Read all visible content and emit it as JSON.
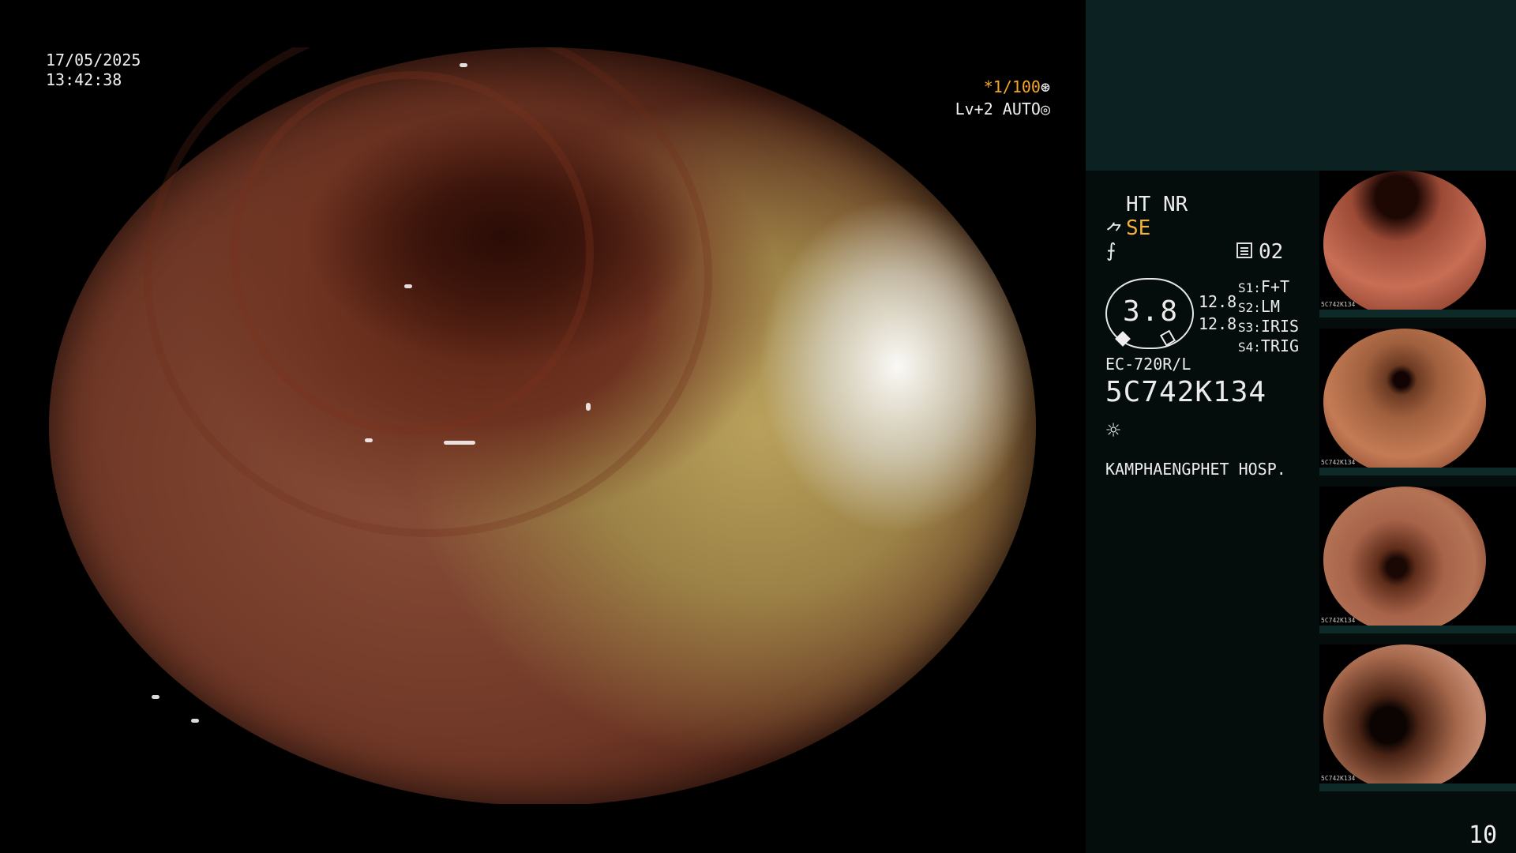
{
  "overlay": {
    "date": "17/05/2025",
    "time": "13:42:38",
    "shutter": "*1/100",
    "level": "Lv+2 AUTO"
  },
  "panel": {
    "mode": "HT NR",
    "se_label": "SE",
    "memo_value": "02",
    "dial_value": "3.8",
    "side_values": [
      "12.8",
      "12.8"
    ],
    "switches": [
      {
        "label": "S1:",
        "value": "F+T"
      },
      {
        "label": "S2:",
        "value": "LM"
      },
      {
        "label": "S3:",
        "value": "IRIS"
      },
      {
        "label": "S4:",
        "value": "TRIG"
      }
    ],
    "scope_model": "EC-720R/L",
    "scope_serial": "5C742K134",
    "hospital": "KAMPHAENGPHET HOSP."
  },
  "thumbnails": [
    {
      "caption": "5C742K134"
    },
    {
      "caption": "5C742K134"
    },
    {
      "caption": "5C742K134"
    },
    {
      "caption": "5C742K134"
    }
  ],
  "page_number": "10",
  "icons": {
    "shutter_icon": "shutter-icon",
    "auto_icon": "auto-icon",
    "se_icon": "scissor-icon",
    "hook_icon": "knife-icon",
    "memo_icon": "memo-icon",
    "light_icon": "sun-icon"
  },
  "colors": {
    "accent": "#f5a623",
    "panel_top": "#0c2222",
    "panel_bg": "#040d0b"
  }
}
